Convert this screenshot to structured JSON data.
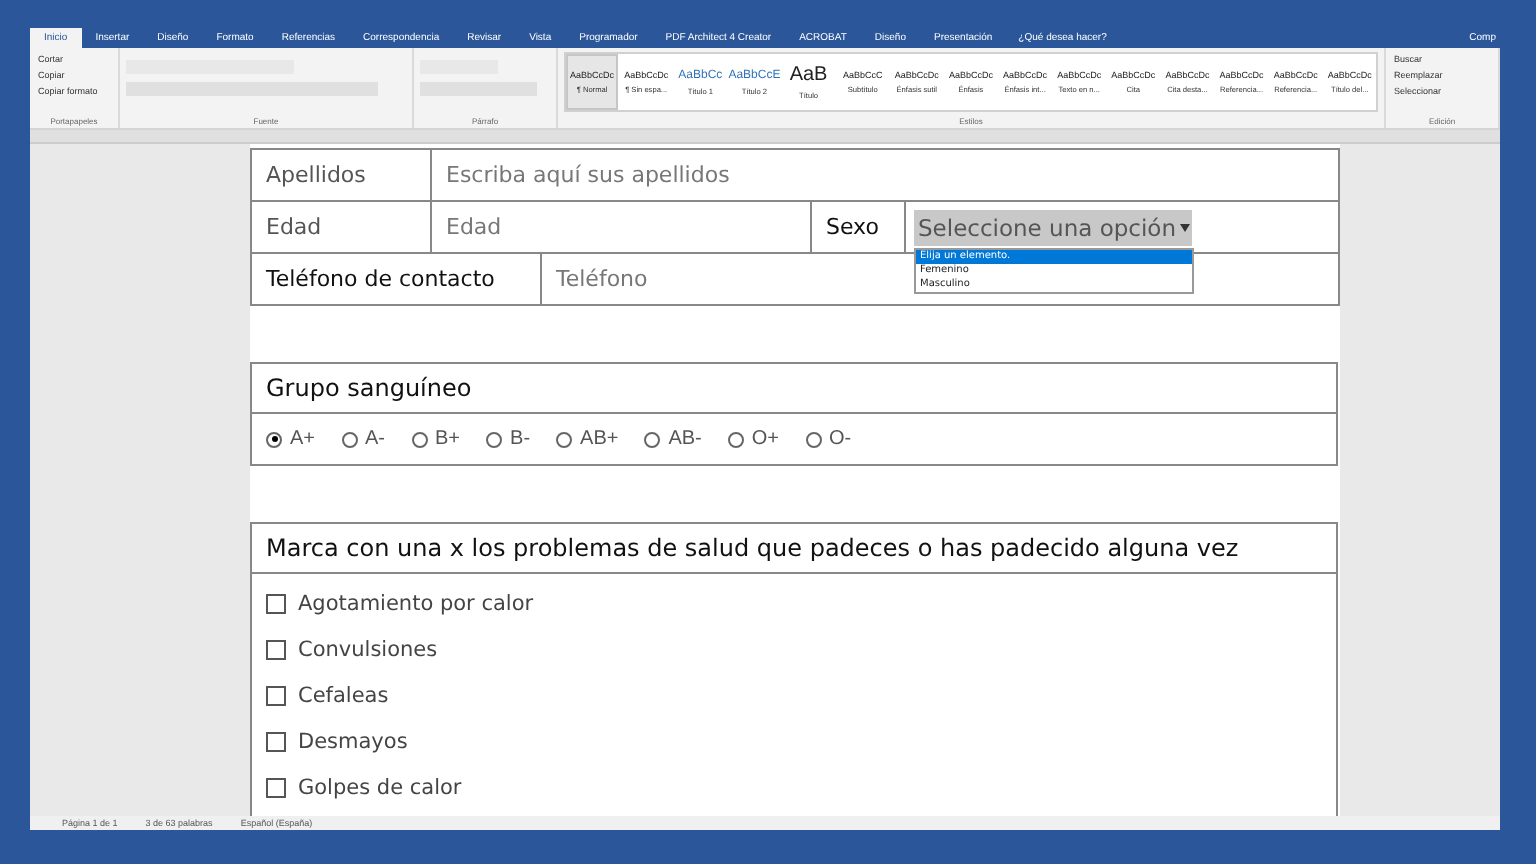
{
  "tabs": [
    {
      "label": "Inicio",
      "selected": true
    },
    {
      "label": "Insertar",
      "selected": false
    },
    {
      "label": "Diseño",
      "selected": false
    },
    {
      "label": "Formato",
      "selected": false
    },
    {
      "label": "Referencias",
      "selected": false
    },
    {
      "label": "Correspondencia",
      "selected": false
    },
    {
      "label": "Revisar",
      "selected": false
    },
    {
      "label": "Vista",
      "selected": false
    },
    {
      "label": "Programador",
      "selected": false
    },
    {
      "label": "PDF Architect 4 Creator",
      "selected": false
    },
    {
      "label": "ACROBAT",
      "selected": false
    },
    {
      "label": "Diseño",
      "selected": false
    },
    {
      "label": "Presentación",
      "selected": false
    }
  ],
  "tell_me": "¿Qué desea hacer?",
  "share": "Comp",
  "clipboard": {
    "items": [
      "Cortar",
      "Copiar",
      "Copiar formato"
    ],
    "label": "Portapapeles"
  },
  "font_label": "Fuente",
  "paragraph_label": "Párrafo",
  "styles": {
    "label": "Estilos",
    "items": [
      {
        "sample": "AaBbCcDc",
        "name": "¶ Normal",
        "selected": true
      },
      {
        "sample": "AaBbCcDc",
        "name": "¶ Sin espa...",
        "selected": false
      },
      {
        "sample": "AaBbCc",
        "name": "Título 1",
        "selected": false
      },
      {
        "sample": "AaBbCcE",
        "name": "Título 2",
        "selected": false
      },
      {
        "sample": "AaB",
        "name": "Título",
        "selected": false
      },
      {
        "sample": "AaBbCcC",
        "name": "Subtítulo",
        "selected": false
      },
      {
        "sample": "AaBbCcDc",
        "name": "Énfasis sutil",
        "selected": false
      },
      {
        "sample": "AaBbCcDc",
        "name": "Énfasis",
        "selected": false
      },
      {
        "sample": "AaBbCcDc",
        "name": "Énfasis int...",
        "selected": false
      },
      {
        "sample": "AaBbCcDc",
        "name": "Texto en n...",
        "selected": false
      },
      {
        "sample": "AaBbCcDc",
        "name": "Cita",
        "selected": false
      },
      {
        "sample": "AaBbCcDc",
        "name": "Cita desta...",
        "selected": false
      },
      {
        "sample": "AaBbCcDc",
        "name": "Referencia...",
        "selected": false
      },
      {
        "sample": "AaBbCcDc",
        "name": "Referencia...",
        "selected": false
      },
      {
        "sample": "AaBbCcDc",
        "name": "Título del...",
        "selected": false
      }
    ]
  },
  "editing": {
    "items": [
      "Buscar",
      "Reemplazar",
      "Seleccionar"
    ],
    "label": "Edición"
  },
  "personal": {
    "surname_label": "Apellidos",
    "surname_value": "Escriba aquí sus apellidos",
    "age_label": "Edad",
    "age_placeholder": "Edad",
    "sex_label": "Sexo",
    "sex_select": "Seleccione una opción",
    "sex_options": [
      {
        "label": "Elija un elemento.",
        "selected": true
      },
      {
        "label": "Femenino",
        "selected": false
      },
      {
        "label": "Masculino",
        "selected": false
      }
    ],
    "phone_label": "Teléfono de contacto",
    "phone_placeholder": "Teléfono"
  },
  "blood": {
    "title": "Grupo sanguíneo",
    "options": [
      {
        "label": "A+",
        "selected": true
      },
      {
        "label": "A-",
        "selected": false
      },
      {
        "label": "B+",
        "selected": false
      },
      {
        "label": "B-",
        "selected": false
      },
      {
        "label": "AB+",
        "selected": false
      },
      {
        "label": "AB-",
        "selected": false
      },
      {
        "label": "O+",
        "selected": false
      },
      {
        "label": "O-",
        "selected": false
      }
    ]
  },
  "health": {
    "title": "Marca con una x los problemas de salud que padeces o has padecido alguna vez",
    "items": [
      {
        "label": "Agotamiento por calor",
        "checked": false
      },
      {
        "label": "Convulsiones",
        "checked": false
      },
      {
        "label": "Cefaleas",
        "checked": false
      },
      {
        "label": "Desmayos",
        "checked": false
      },
      {
        "label": "Golpes de calor",
        "checked": false
      }
    ]
  },
  "status_bar": {
    "page": "Página 1 de 1",
    "words": "3 de 63 palabras",
    "language": "Español (España)"
  }
}
